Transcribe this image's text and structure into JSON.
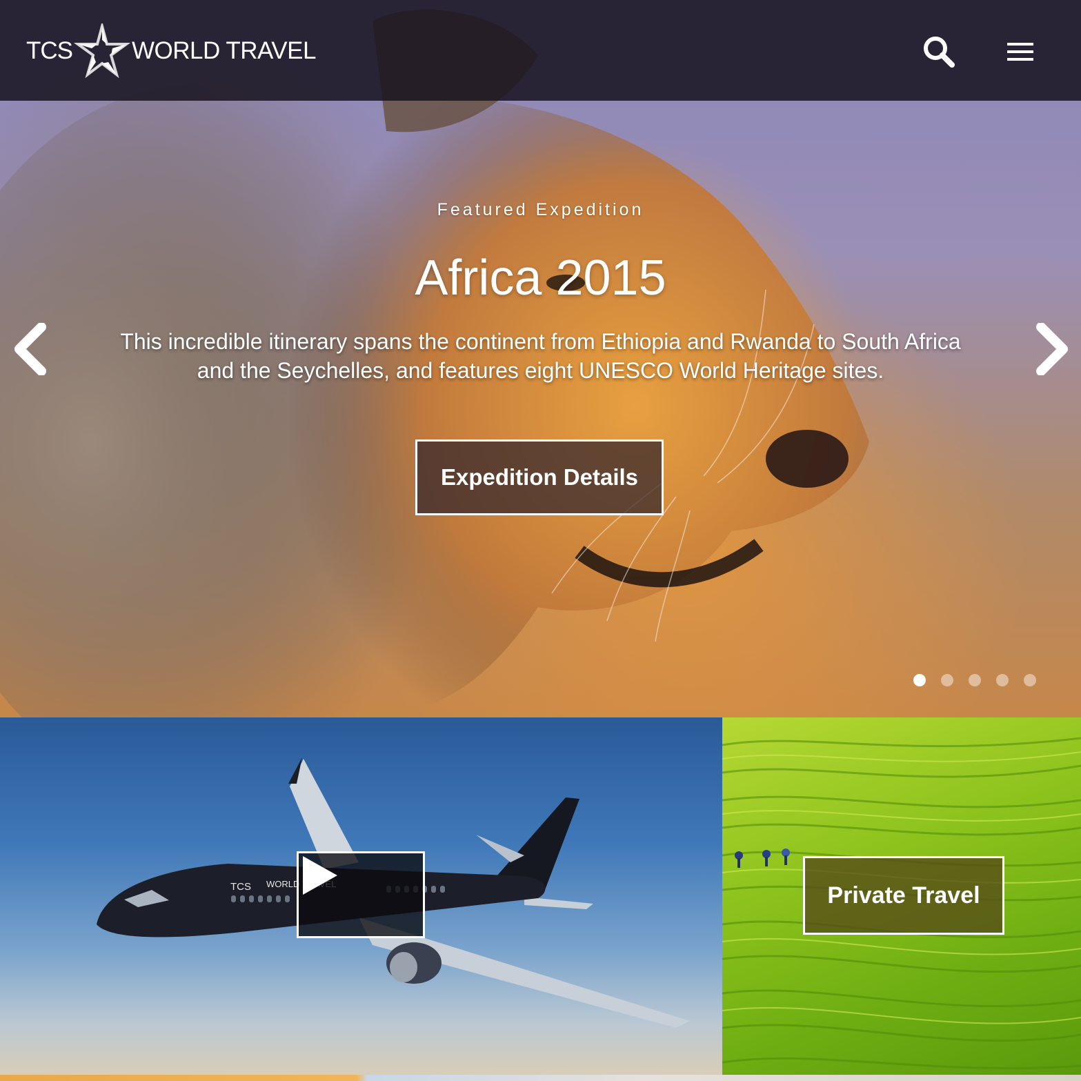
{
  "header": {
    "logo_left": "TCS",
    "logo_right": "WORLD TRAVEL",
    "search_icon": "search-icon",
    "menu_icon": "hamburger-menu-icon"
  },
  "hero": {
    "eyebrow": "Featured Expedition",
    "title": "Africa 2015",
    "description": "This incredible itinerary spans the continent from Ethiopia and Rwanda to South Africa and the Seychelles, and features eight UNESCO World Heritage sites.",
    "button_label": "Expedition Details",
    "prev_icon": "chevron-left-icon",
    "next_icon": "chevron-right-icon",
    "slide_count": 5,
    "active_slide": 1
  },
  "tiles": {
    "video": {
      "play_icon": "play-icon",
      "plane_text_left": "TCS",
      "plane_text_right": "WORLD TRAVEL"
    },
    "private_travel": {
      "button_label": "Private Travel"
    }
  },
  "colors": {
    "navbar_bg": "#181420",
    "text": "#ffffff",
    "accent_green": "#8cc21c"
  }
}
